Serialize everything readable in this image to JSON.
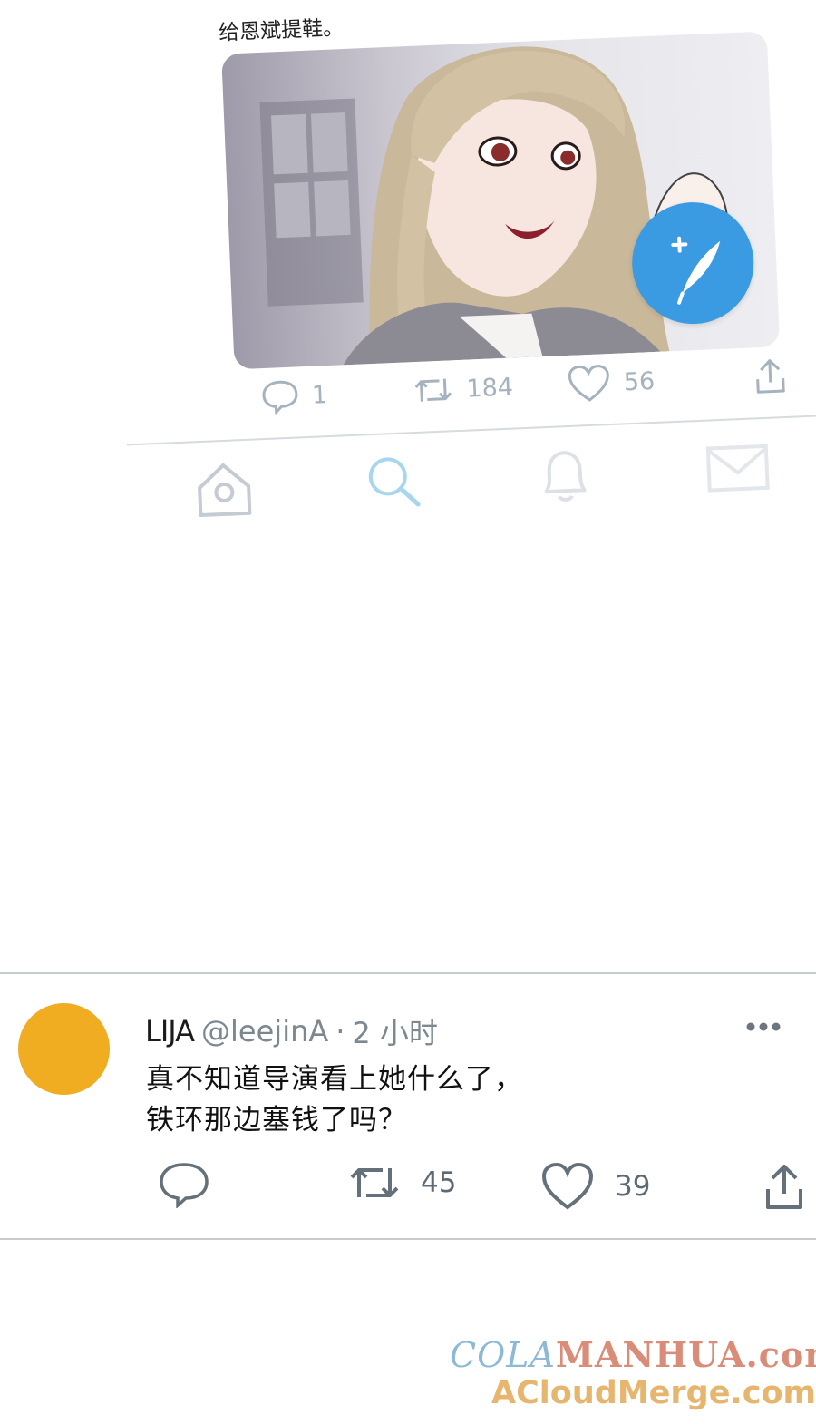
{
  "top_panel": {
    "caption": "给恩斌提鞋。",
    "image": {
      "alt_icon": "illustration-woman-smiling"
    },
    "compose_button_icon": "feather-plus-icon",
    "actions": {
      "reply_count": "1",
      "retweet_count": "184",
      "like_count": "56"
    },
    "nav_icons": [
      "home-icon",
      "search-icon",
      "bell-icon",
      "mail-icon"
    ]
  },
  "tweet": {
    "name": "LIJA",
    "handle": "@leejinA",
    "dot": "·",
    "time": "2 小时",
    "text_line1": "真不知道导演看上她什么了，",
    "text_line2": "铁环那边塞钱了吗？",
    "avatar_color": "#F0AD22",
    "actions": {
      "retweet_count": "45",
      "like_count": "39"
    }
  },
  "watermark": {
    "line1_part1": "COLA",
    "line1_part2": "MANHUA.com",
    "line2": "ACloudMerge.com"
  },
  "colors": {
    "accent": "#3A9BE3",
    "icon_gray": "#64707A",
    "faded_gray": "#A6B3BF"
  }
}
